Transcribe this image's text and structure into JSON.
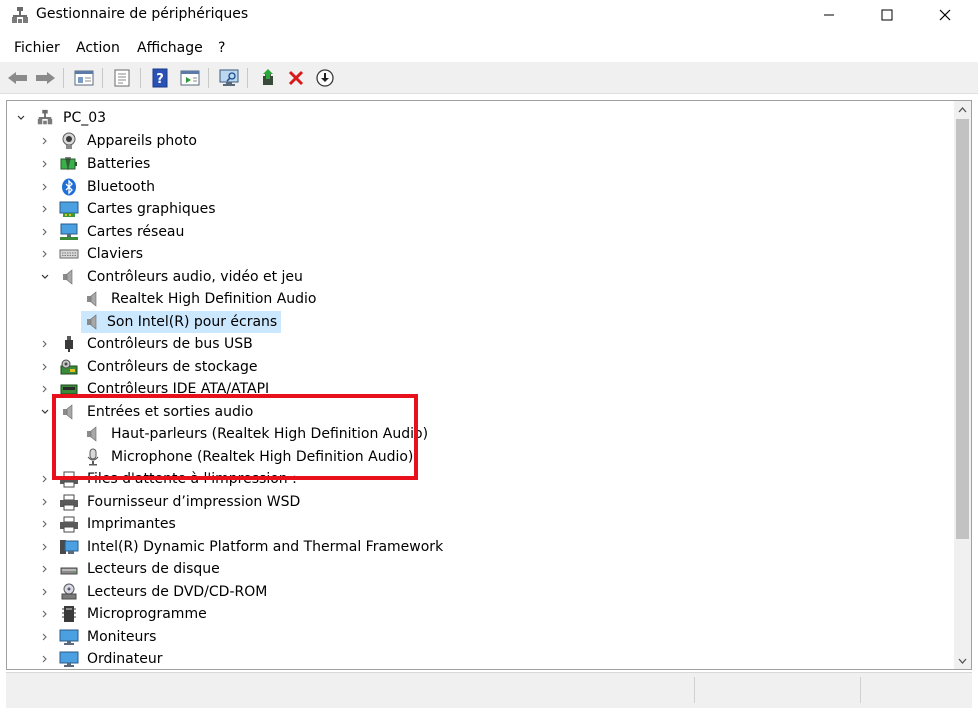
{
  "window": {
    "title": "Gestionnaire de périphériques"
  },
  "menu": [
    "Fichier",
    "Action",
    "Affichage",
    "?"
  ],
  "toolbar": {
    "buttons": [
      "back-arrow-icon",
      "forward-arrow-icon",
      "console-tree-icon",
      "properties-icon",
      "help-icon",
      "action-pane-icon",
      "monitor-scan-icon",
      "update-driver-icon",
      "uninstall-icon",
      "download-icon"
    ]
  },
  "tree": {
    "root": "PC_03",
    "items": [
      {
        "label": "Appareils photo",
        "icon": "camera-icon",
        "level": 1,
        "expanded": false
      },
      {
        "label": "Batteries",
        "icon": "battery-icon",
        "level": 1,
        "expanded": false
      },
      {
        "label": "Bluetooth",
        "icon": "bluetooth-icon",
        "level": 1,
        "expanded": false
      },
      {
        "label": "Cartes graphiques",
        "icon": "display-adapter-icon",
        "level": 1,
        "expanded": false
      },
      {
        "label": "Cartes réseau",
        "icon": "network-adapter-icon",
        "level": 1,
        "expanded": false
      },
      {
        "label": "Claviers",
        "icon": "keyboard-icon",
        "level": 1,
        "expanded": false
      },
      {
        "label": "Contrôleurs audio, vidéo et jeu",
        "icon": "speaker-icon",
        "level": 1,
        "expanded": true
      },
      {
        "label": "Realtek High Definition Audio",
        "icon": "speaker-icon",
        "level": 2
      },
      {
        "label": "Son Intel(R) pour écrans",
        "icon": "speaker-icon",
        "level": 2,
        "selected": true
      },
      {
        "label": "Contrôleurs de bus USB",
        "icon": "usb-icon",
        "level": 1,
        "expanded": false
      },
      {
        "label": "Contrôleurs de stockage",
        "icon": "storage-controller-icon",
        "level": 1,
        "expanded": false
      },
      {
        "label": "Contrôleurs IDE ATA/ATAPI",
        "icon": "ide-controller-icon",
        "level": 1,
        "expanded": false
      },
      {
        "label": "Entrées et sorties audio",
        "icon": "speaker-icon",
        "level": 1,
        "expanded": true
      },
      {
        "label": "Haut-parleurs (Realtek High Definition Audio)",
        "icon": "speaker-icon",
        "level": 2
      },
      {
        "label": "Microphone (Realtek High Definition Audio)",
        "icon": "microphone-icon",
        "level": 2
      },
      {
        "label": "Files d'attente à l'impression :",
        "icon": "printer-icon",
        "level": 1,
        "expanded": false
      },
      {
        "label": "Fournisseur d’impression WSD",
        "icon": "printer-icon",
        "level": 1,
        "expanded": false
      },
      {
        "label": "Imprimantes",
        "icon": "printer-icon",
        "level": 1,
        "expanded": false
      },
      {
        "label": "Intel(R) Dynamic Platform and Thermal Framework",
        "icon": "computer-icon",
        "level": 1,
        "expanded": false
      },
      {
        "label": "Lecteurs de disque",
        "icon": "disk-drive-icon",
        "level": 1,
        "expanded": false
      },
      {
        "label": "Lecteurs de DVD/CD-ROM",
        "icon": "dvd-drive-icon",
        "level": 1,
        "expanded": false
      },
      {
        "label": "Microprogramme",
        "icon": "firmware-icon",
        "level": 1,
        "expanded": false
      },
      {
        "label": "Moniteurs",
        "icon": "monitor-icon",
        "level": 1,
        "expanded": false
      },
      {
        "label": "Ordinateur",
        "icon": "monitor-icon",
        "level": 1,
        "expanded": false
      }
    ]
  },
  "colors": {
    "highlight_box": "#e8101a",
    "selection": "#cce8ff"
  }
}
